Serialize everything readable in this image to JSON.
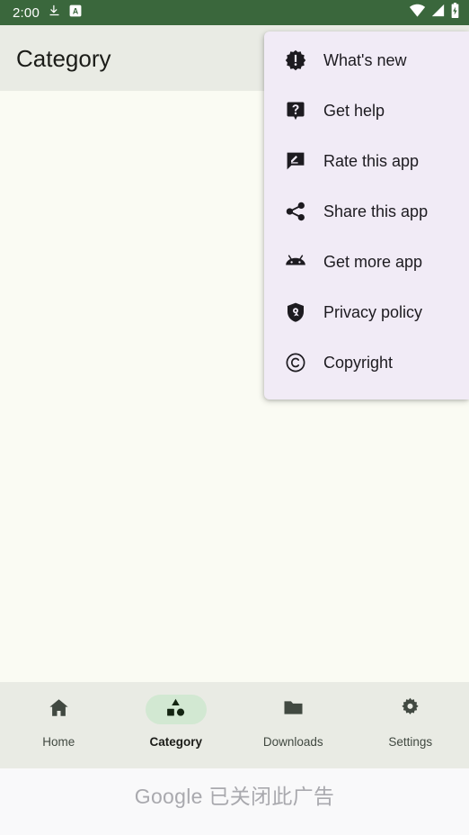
{
  "status_bar": {
    "clock": "2:00",
    "background_color": "#3A673C",
    "icons_left": [
      "download-icon",
      "a-badge-icon"
    ],
    "icons_right": [
      "wifi-icon",
      "cellular-signal-icon",
      "battery-charging-icon"
    ]
  },
  "app_bar": {
    "title": "Category",
    "background_color": "#E9EBE4"
  },
  "overflow_menu": {
    "background_color": "#F1EBF6",
    "items": [
      {
        "label": "What's new",
        "icon": "new-releases-icon"
      },
      {
        "label": "Get help",
        "icon": "help-badge-icon"
      },
      {
        "label": "Rate this app",
        "icon": "rate-review-icon"
      },
      {
        "label": "Share this app",
        "icon": "share-icon"
      },
      {
        "label": "Get more app",
        "icon": "android-icon"
      },
      {
        "label": "Privacy policy",
        "icon": "privacy-shield-icon"
      },
      {
        "label": "Copyright",
        "icon": "copyright-icon"
      }
    ]
  },
  "bottom_nav": {
    "background_color": "#E9EBE4",
    "active_pill_color": "#D2E8D2",
    "selected": "Category",
    "items": [
      {
        "label": "Home",
        "icon": "home-icon",
        "selected": false
      },
      {
        "label": "Category",
        "icon": "category-icon",
        "selected": true
      },
      {
        "label": "Downloads",
        "icon": "folder-icon",
        "selected": false
      },
      {
        "label": "Settings",
        "icon": "gear-icon",
        "selected": false
      }
    ]
  },
  "ad_banner": {
    "text": "Google 已关闭此广告",
    "background_color": "#F9F9FA",
    "text_color": "#A9A9AE"
  }
}
